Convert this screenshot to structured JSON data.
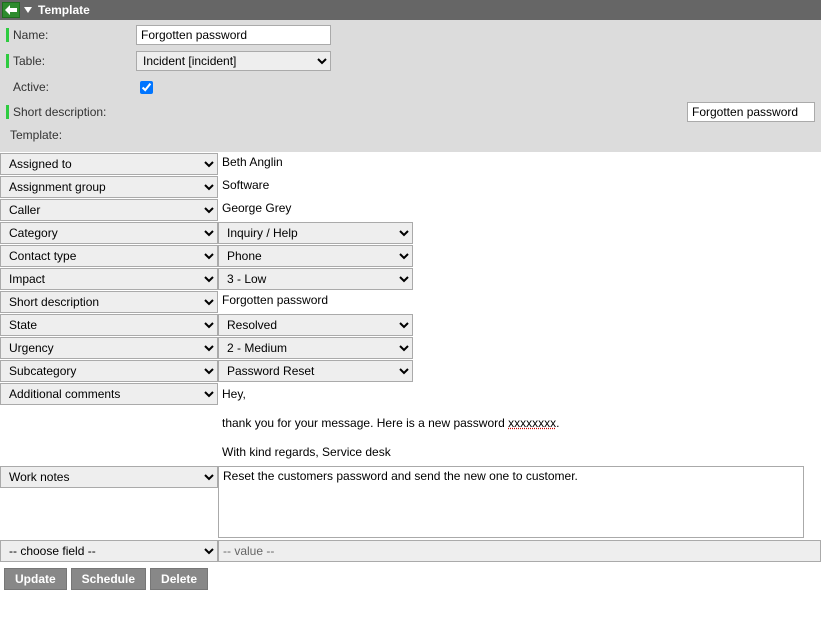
{
  "header": {
    "title": "Template"
  },
  "form": {
    "name": {
      "label": "Name:",
      "value": "Forgotten password"
    },
    "table": {
      "label": "Table:",
      "value": "Incident [incident]"
    },
    "active": {
      "label": "Active:",
      "checked": true
    },
    "short_description": {
      "label": "Short description:",
      "value": "Forgotten password"
    },
    "template_label": "Template:"
  },
  "template_rows": [
    {
      "field": "Assigned to",
      "type": "text",
      "value": "Beth Anglin"
    },
    {
      "field": "Assignment group",
      "type": "text",
      "value": "Software"
    },
    {
      "field": "Caller",
      "type": "text",
      "value": "George Grey"
    },
    {
      "field": "Category",
      "type": "select",
      "value": "Inquiry / Help"
    },
    {
      "field": "Contact type",
      "type": "select",
      "value": "Phone"
    },
    {
      "field": "Impact",
      "type": "select",
      "value": "3 - Low"
    },
    {
      "field": "Short description",
      "type": "text",
      "value": "Forgotten password"
    },
    {
      "field": "State",
      "type": "select",
      "value": "Resolved"
    },
    {
      "field": "Urgency",
      "type": "select",
      "value": "2 - Medium"
    },
    {
      "field": "Subcategory",
      "type": "select",
      "value": "Password Reset"
    },
    {
      "field": "Additional comments",
      "type": "comment",
      "lines": [
        "Hey,",
        "thank you for your message. Here is a new password xxxxxxxx.",
        "With kind regards, Service desk"
      ]
    },
    {
      "field": "Work notes",
      "type": "textarea",
      "value": "Reset the customers password and send the new one to customer."
    }
  ],
  "choose": {
    "field_placeholder": "-- choose field --",
    "value_placeholder": "-- value --"
  },
  "buttons": {
    "update": "Update",
    "schedule": "Schedule",
    "delete": "Delete"
  }
}
